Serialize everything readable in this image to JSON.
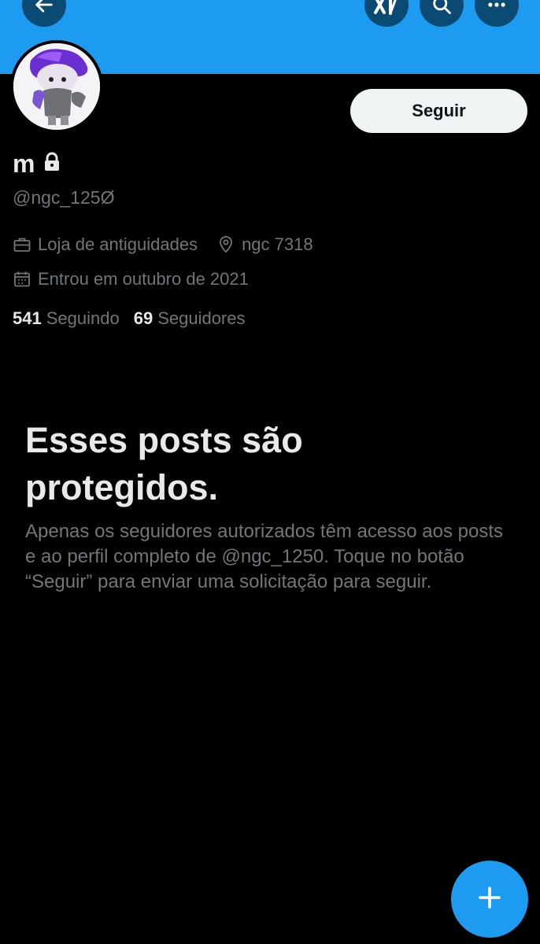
{
  "header": {
    "back_icon": "arrow-left-icon",
    "grok_icon": "grok-icon",
    "search_icon": "search-icon",
    "more_icon": "more-icon",
    "banner_color": "#1d9bf0"
  },
  "profile": {
    "name": "m",
    "locked_icon": "lock-icon",
    "handle": "@ngc_125Ø",
    "follow_label": "Seguir",
    "profession": "Loja de antiguidades",
    "location": "ngc 7318",
    "joined": "Entrou em outubro de 2021",
    "following_count": "541",
    "following_label": "Seguindo",
    "followers_count": "69",
    "followers_label": "Seguidores"
  },
  "protected": {
    "title": "Esses posts são protegidos.",
    "text": "Apenas os seguidores autorizados têm acesso aos posts e ao perfil completo de @ngc_1250. Toque no botão “Seguir” para enviar uma solicitação para seguir."
  },
  "fab": {
    "icon": "plus-icon"
  },
  "colors": {
    "accent": "#1d9bf0",
    "background": "#000000",
    "muted": "#71767b"
  }
}
